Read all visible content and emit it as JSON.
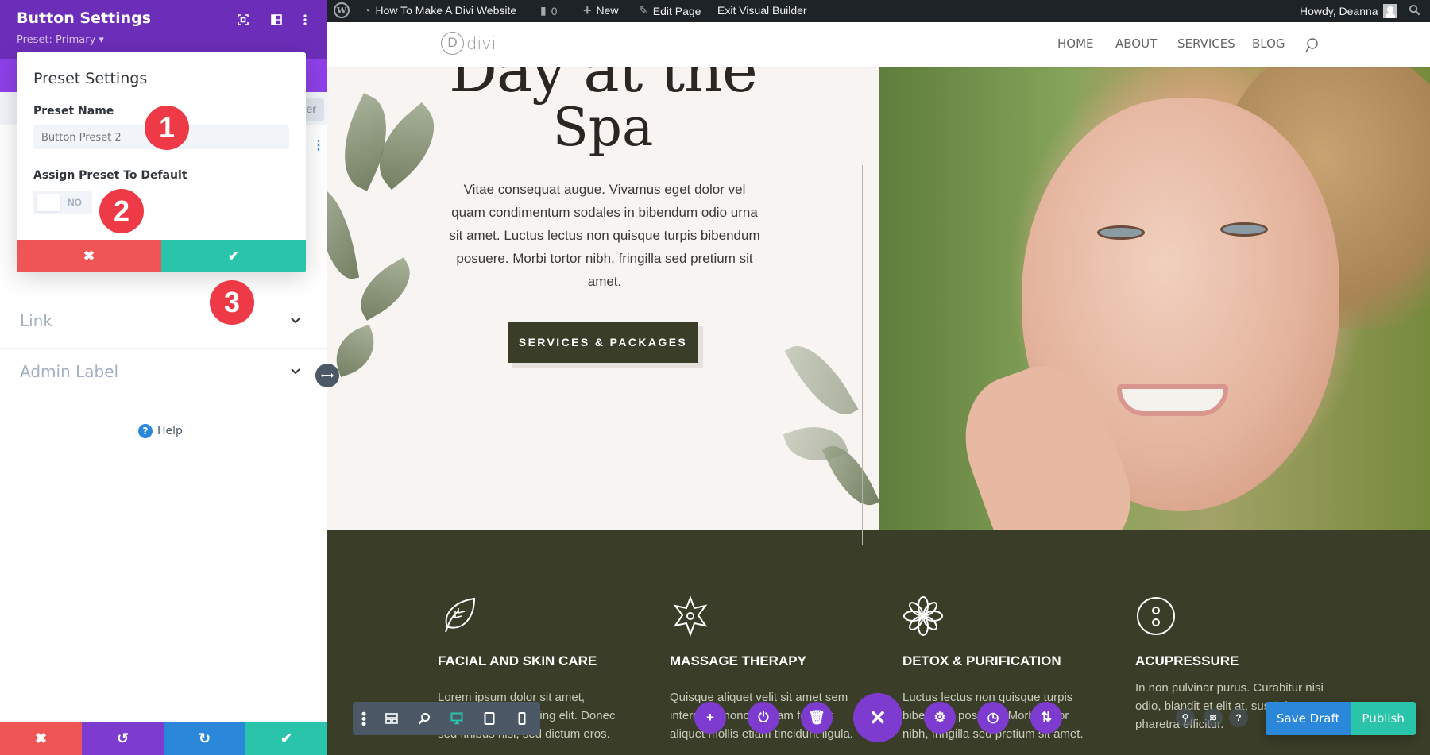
{
  "settings_panel": {
    "title": "Button Settings",
    "preset_selector": "Preset: Primary ▾",
    "header_icons": [
      "screenshot-icon",
      "split-view-icon",
      "more-options-icon"
    ],
    "filter_label_partial": "er",
    "sections": [
      {
        "label": "Link"
      },
      {
        "label": "Admin Label"
      }
    ],
    "help_label": "Help",
    "footer_buttons": [
      {
        "name": "discard",
        "glyph": "✖"
      },
      {
        "name": "undo",
        "glyph": "↺"
      },
      {
        "name": "redo",
        "glyph": "↻"
      },
      {
        "name": "save",
        "glyph": "✔"
      }
    ],
    "colors": {
      "header": "#6c2eb9",
      "tabs": "#8e40e8",
      "red": "#ef5555",
      "purple": "#7e3bd0",
      "blue": "#2b87da",
      "green": "#29c4a9"
    }
  },
  "preset_modal": {
    "title": "Preset Settings",
    "name_label": "Preset Name",
    "name_placeholder": "Button Preset 2",
    "assign_label": "Assign Preset To Default",
    "toggle_value": "NO",
    "cancel_glyph": "✖",
    "confirm_glyph": "✔"
  },
  "annotations": [
    {
      "number": "1",
      "color": "#ee3a46"
    },
    {
      "number": "2",
      "color": "#ee3a46"
    },
    {
      "number": "3",
      "color": "#ee3a46"
    }
  ],
  "admin_bar": {
    "site_name": "How To Make A Divi Website",
    "comments_count": "0",
    "new_label": "New",
    "edit_page_label": "Edit Page",
    "exit_label": "Exit Visual Builder",
    "greeting": "Howdy, Deanna"
  },
  "site_header": {
    "logo_letter": "D",
    "logo_word": "divi",
    "nav": [
      "HOME",
      "ABOUT",
      "SERVICES",
      "BLOG"
    ]
  },
  "hero": {
    "title_line1": "Day at the",
    "title_line2": "Spa",
    "body": "Vitae consequat augue. Vivamus eget dolor vel quam condimentum sodales in bibendum odio urna sit amet. Luctus lectus non quisque turpis bibendum posuere. Morbi tortor nibh, fringilla sed pretium sit amet.",
    "button_label": "SERVICES & PACKAGES"
  },
  "services": [
    {
      "icon": "leaf-icon",
      "title": "FACIAL AND SKIN CARE",
      "text": "Lorem ipsum dolor sit amet, consectetur adipiscing elit. Donec sed finibus nisi, sed dictum eros."
    },
    {
      "icon": "star-icon",
      "title": "MASSAGE THERAPY",
      "text": "Quisque aliquet velit sit amet sem interdum rhoncus. Nam feugiat aliquet mollis etiam tincidunt ligula."
    },
    {
      "icon": "flower-icon",
      "title": "DETOX & PURIFICATION",
      "text": "Luctus lectus non quisque turpis bibendum posuere. Morbi tortor nibh, fringilla sed pretium sit amet."
    },
    {
      "icon": "acupressure-icon",
      "title": "ACUPRESSURE",
      "text": "In non pulvinar purus. Curabitur nisi odio, blandit et elit at, suscipit pharetra efficitur."
    }
  ],
  "builder_bar": {
    "device_modes": [
      "wireframe",
      "zoom",
      "desktop",
      "tablet",
      "phone"
    ],
    "active_mode": "desktop",
    "section_actions": [
      "add",
      "portability",
      "clear",
      "close",
      "page-settings",
      "history",
      "import-export"
    ],
    "right_icons": [
      "find-replace",
      "layers",
      "help"
    ],
    "save_draft_label": "Save Draft",
    "publish_label": "Publish"
  }
}
